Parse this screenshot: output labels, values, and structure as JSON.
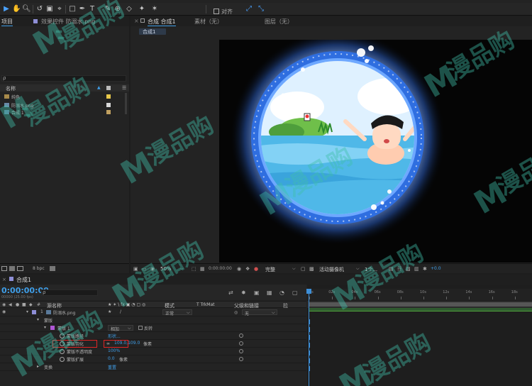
{
  "toolbar": {
    "align_label": "对齐"
  },
  "project_panel": {
    "tab_project": "项目",
    "tab_effects": "效果控件 防溺水.png",
    "search_placeholder": "ρ",
    "col_name": "名称",
    "items": [
      {
        "label": "纯色",
        "chip": "#e8c84a"
      },
      {
        "label": "防溺水.png",
        "chip": "#d8d8d8"
      },
      {
        "label": "合成 1",
        "chip": "#c0a060"
      }
    ],
    "bpc": "8 bpc"
  },
  "viewer": {
    "tab_comp": "合成 合成1",
    "tab_footage": "素材（无）",
    "tab_layer": "图层（无）",
    "comp_sub_tab": "合成1",
    "zoom": "50%",
    "timecode": "0:00:00:00",
    "resolution": "完整",
    "camera": "活动摄像机",
    "views": "1个...",
    "exposure": "+0.0"
  },
  "timeline": {
    "comp_tab": "合成1",
    "timecode": "0:00:00:00",
    "fps_note": "00000 (25.00 fps)",
    "col_source": "源名称",
    "col_mode": "模式",
    "col_trkmat": "T  TrkMat",
    "col_parent": "父级和链接",
    "col_stretch": "拉",
    "ruler_ticks": [
      "0s",
      "02s",
      "04s",
      "06s",
      "08s",
      "10s",
      "12s",
      "14s",
      "16s",
      "18s"
    ],
    "layer": {
      "index": "1",
      "name": "防溺水.png",
      "mode": "正常",
      "parent": "无"
    },
    "group_masks": "蒙版",
    "mask1": {
      "name": "蒙版 1",
      "mode": "相加",
      "inverted_label": "反转"
    },
    "props": [
      {
        "label": "蒙版路径",
        "value": "形状..."
      },
      {
        "label": "蒙版羽化",
        "value": "109.0,109.0",
        "unit": "像素"
      },
      {
        "label": "蒙版不透明度",
        "value": "100%"
      },
      {
        "label": "蒙版扩展",
        "value": "0.0",
        "unit": "像素"
      }
    ],
    "transform_label": "变换",
    "transform_value": "重置"
  },
  "watermark": {
    "logo_letter": "M",
    "text": "漫品购"
  },
  "colors": {
    "accent": "#3f9ee8",
    "highlight_box": "#e02424",
    "layer_label": "#8e8ed6"
  }
}
